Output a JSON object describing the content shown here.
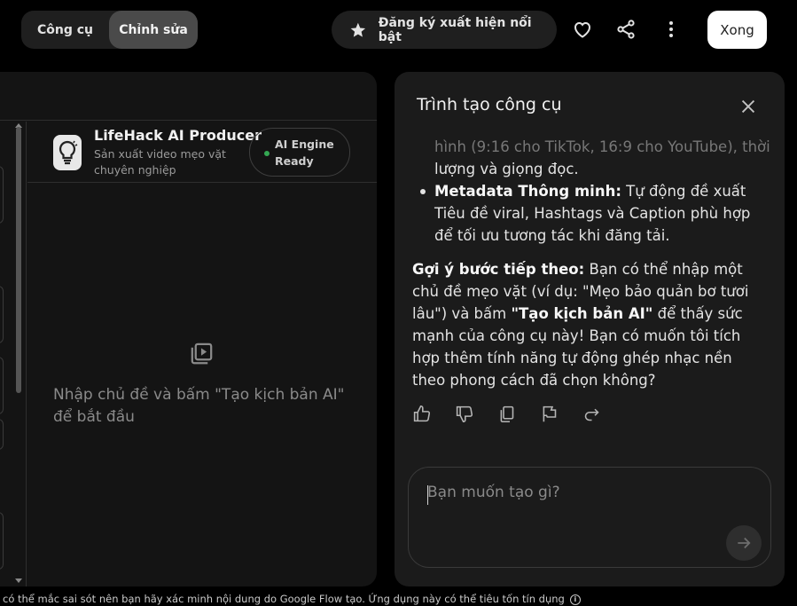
{
  "topbar": {
    "tab_tools": "Công cụ",
    "tab_edit": "Chỉnh sửa",
    "feature_label": "Đăng ký xuất hiện nổi bật",
    "done_label": "Xong"
  },
  "preview": {
    "app_title": "LifeHack AI Producer",
    "app_subtitle": "Sản xuất video mẹo vặt chuyên nghiệp",
    "engine_badge_line1": "AI Engine",
    "engine_badge_line2": "Ready",
    "empty_message": "Nhập chủ đề và bấm \"Tạo kịch bản AI\" để bắt đầu"
  },
  "builder": {
    "title": "Trình tạo công cụ",
    "partial_line": "hình (9:16 cho TikTok, 16:9 cho YouTube), thời",
    "line_continuation": "lượng và giọng đọc.",
    "bullet_title": "Metadata Thông minh:",
    "bullet_text": " Tự động đề xuất Tiêu đề viral, Hashtags và Caption phù hợp để tối ưu tương tác khi đăng tải.",
    "next_title": "Gợi ý bước tiếp theo:",
    "next_text_1": " Bạn có thể nhập một chủ đề mẹo vặt (ví dụ: \"Mẹo bảo quản bơ tươi lâu\") và bấm ",
    "next_bold": "\"Tạo kịch bản AI\"",
    "next_text_2": " để thấy sức mạnh của công cụ này! Bạn có muốn tôi tích hợp thêm tính năng tự động ghép nhạc nền theo phong cách đã chọn không?",
    "input_placeholder": "Bạn muốn tạo gì?"
  },
  "footer": {
    "disclaimer": "có thể mắc sai sót nên bạn hãy xác minh nội dung do Google Flow tạo. Ứng dụng này có thể tiêu tốn tín dụng"
  },
  "colors": {
    "background": "#000000",
    "panel": "#1b1b1b",
    "status_green": "#34a853"
  }
}
